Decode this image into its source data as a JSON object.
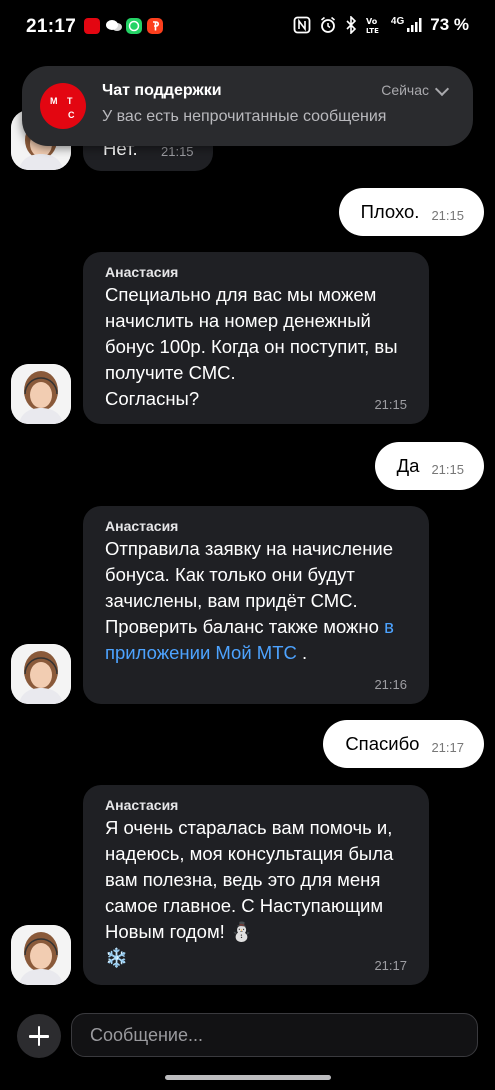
{
  "status_bar": {
    "time": "21:17",
    "network": "4G",
    "battery": "73 %"
  },
  "notification": {
    "title": "Чат поддержки",
    "subtitle": "У вас есть непрочитанные сообщения",
    "when": "Сейчас",
    "logo_letters": [
      "М",
      "Т",
      "С"
    ]
  },
  "messages": {
    "partial": {
      "text": "Нет.",
      "time": "21:15"
    },
    "out1": {
      "text": "Плохо.",
      "time": "21:15"
    },
    "in1": {
      "author": "Анастасия",
      "text": "Специально для вас мы можем начислить на номер денежный бонус 100р. Когда он поступит, вы получите СМС.\nСогласны?",
      "time": "21:15"
    },
    "out2": {
      "text": "Да",
      "time": "21:15"
    },
    "in2": {
      "author": "Анастасия",
      "text_before": "Отправила заявку на начисление бонуса. Как только они будут зачислены, вам придёт СМС. Проверить баланс также можно ",
      "link": "в приложении Мой МТС",
      "text_after": " .",
      "time": "21:16"
    },
    "out3": {
      "text": "Спасибо",
      "time": "21:17"
    },
    "in3": {
      "author": "Анастасия",
      "text": "Я очень старалась вам помочь и, надеюсь, моя консультация была вам полезна, ведь это для меня самое главное. С Наступающим Новым годом! ⛄\n❄️",
      "time": "21:17"
    }
  },
  "composer": {
    "placeholder": "Сообщение..."
  },
  "colors": {
    "brand": "#e30611",
    "link": "#4da3ff",
    "incoming_bubble": "#1f2024",
    "outgoing_bubble": "#ffffff"
  }
}
